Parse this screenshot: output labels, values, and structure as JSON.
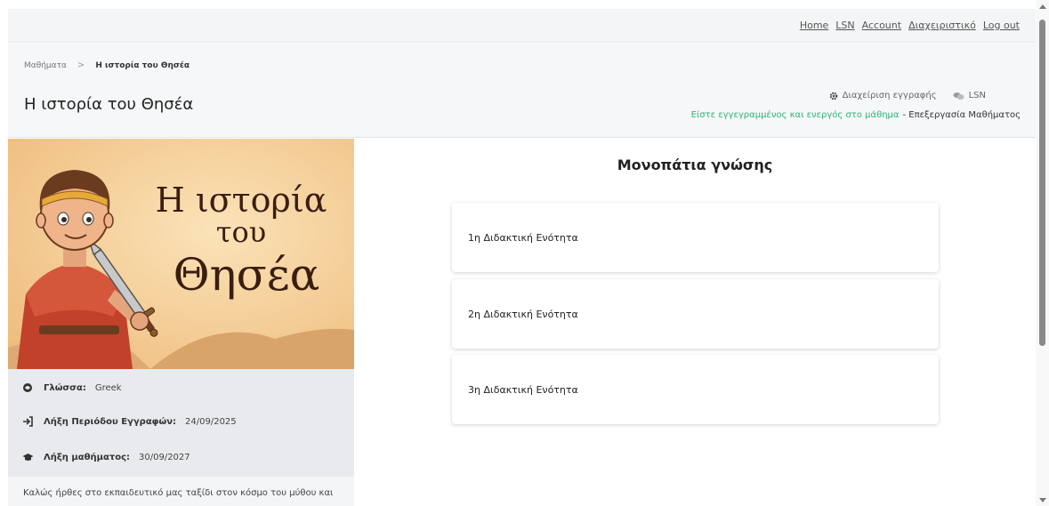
{
  "topnav": {
    "links": [
      "Home",
      "LSN",
      "Account",
      "Διαχειριστικό",
      "Log out"
    ]
  },
  "breadcrumb": {
    "root": "Μαθήματα",
    "current": "Η ιστορία του Θησέα"
  },
  "course": {
    "title": "Η ιστορία του Θησέα",
    "hero_text_line1": "Η ιστορία",
    "hero_text_line2": "του",
    "hero_text_line3": "Θησέα"
  },
  "actions": {
    "manage_enrollment": "Διαχείριση εγγραφής",
    "lsn": "LSN",
    "enrolled_status": "Είστε εγγεγραμμένος και ενεργός στο μάθημα",
    "edit_course": "- Επεξεργασία Μαθήματος"
  },
  "info": {
    "language_label": "Γλώσσα:",
    "language_value": "Greek",
    "enroll_end_label": "Λήξη Περιόδου Εγγραφών:",
    "enroll_end_value": "24/09/2025",
    "course_end_label": "Λήξη μαθήματος:",
    "course_end_value": "30/09/2027"
  },
  "welcome_text": "Καλώς ήρθες στο εκπαιδευτικό μας ταξίδι στον κόσμο του μύθου και",
  "paths": {
    "title": "Μονοπάτια γνώσης",
    "units": [
      "1η Διδακτική Ενότητα",
      "2η Διδακτική Ενότητα",
      "3η Διδακτική Ενότητα"
    ]
  },
  "colors": {
    "enrolled_green": "#2bb673",
    "hero_bg": "#f4c98e"
  }
}
